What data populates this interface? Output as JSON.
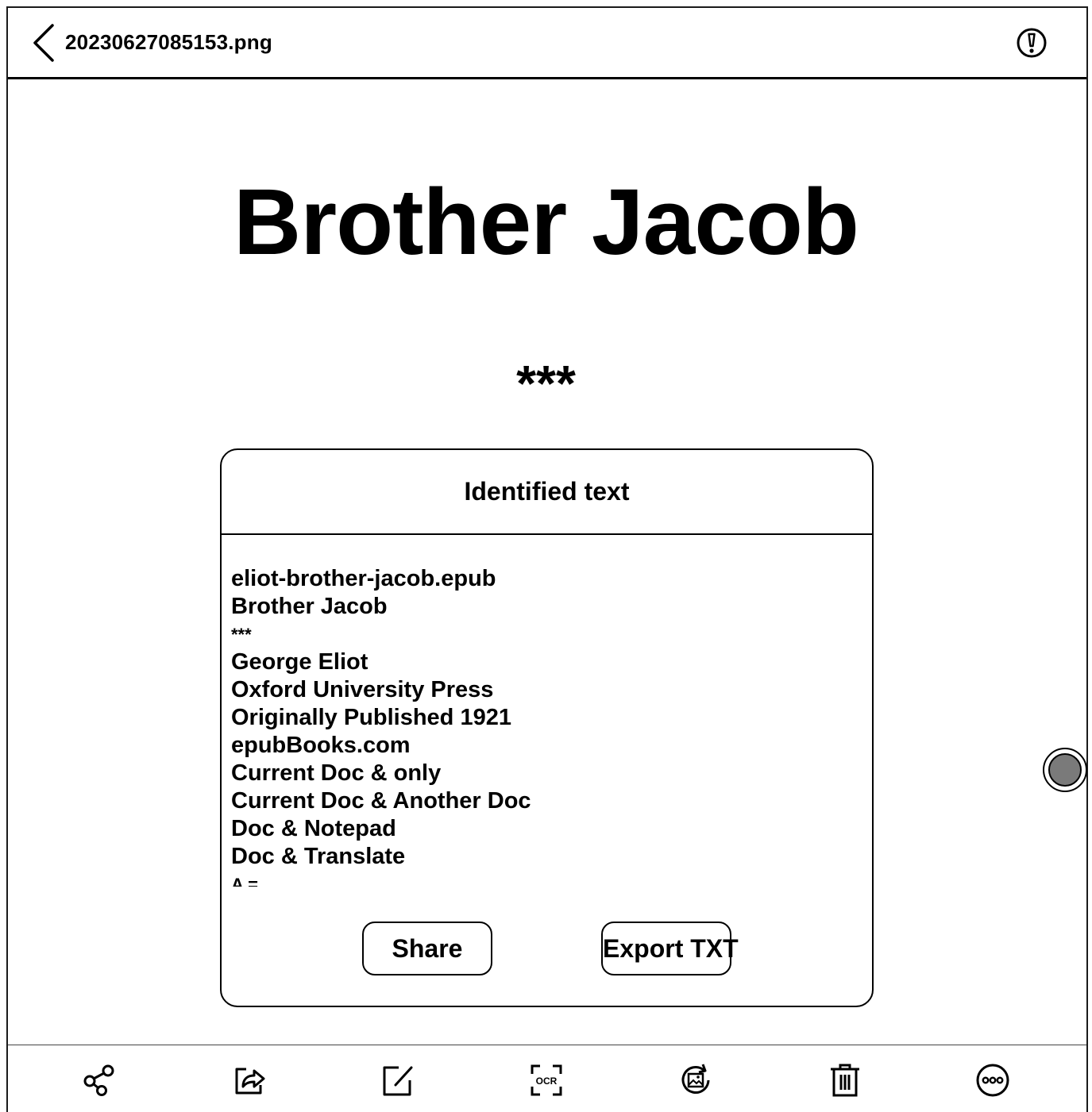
{
  "header": {
    "back_icon": "chevron-left-icon",
    "file_name": "20230627085153.png",
    "info_icon": "exclamation-circle-icon"
  },
  "document": {
    "title": "Brother Jacob",
    "separator": "***"
  },
  "ocr_dialog": {
    "title": "Identified text",
    "lines": [
      "eliot-brother-jacob.epub",
      "Brother Jacob",
      "***",
      "George Eliot",
      "Oxford University Press",
      "Originally Published 1921",
      "epubBooks.com",
      "Current Doc & only",
      "Current Doc & Another Doc",
      "Doc & Notepad",
      "Doc & Translate",
      "A ="
    ],
    "share_label": "Share",
    "export_label": "Export TXT"
  },
  "toolbar": {
    "items": [
      {
        "icon": "share-nodes-icon"
      },
      {
        "icon": "export-arrow-icon"
      },
      {
        "icon": "edit-pencil-icon"
      },
      {
        "icon": "ocr-scan-icon",
        "label": "OCR"
      },
      {
        "icon": "rotate-image-icon"
      },
      {
        "icon": "trash-icon"
      },
      {
        "icon": "more-options-icon"
      }
    ]
  },
  "colors": {
    "ink": "#000000",
    "background": "#ffffff",
    "handle_fill": "#7a7a7a"
  }
}
